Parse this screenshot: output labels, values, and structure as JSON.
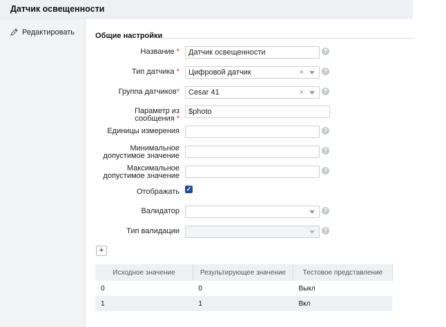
{
  "header": {
    "title": "Датчик освещенности"
  },
  "sidebar": {
    "edit_label": "Редактировать"
  },
  "section": {
    "title": "Общие настройки"
  },
  "form": {
    "name": {
      "label": "Название",
      "required": "*",
      "value": "Датчик освещенности"
    },
    "sensor_type": {
      "label": "Тип датчика",
      "required": "*",
      "value": "Цифровой датчик",
      "clear": "×"
    },
    "sensor_group": {
      "label": "Группа датчиков",
      "required": "*",
      "value": "Cesar 41",
      "clear": "×"
    },
    "message_param": {
      "label": "Параметр из сообщения",
      "required": "*",
      "value": "$photo"
    },
    "units": {
      "label": "Единицы измерения",
      "value": ""
    },
    "min_value": {
      "label_line1": "Минимальное",
      "label_line2": "допустимое значение",
      "value": ""
    },
    "max_value": {
      "label_line1": "Максимальное",
      "label_line2": "допустимое значение",
      "value": ""
    },
    "display": {
      "label": "Отображать",
      "checked": true,
      "check_glyph": "✓"
    },
    "validator": {
      "label": "Валидатор",
      "value": ""
    },
    "validation_type": {
      "label": "Тип валидации",
      "value": ""
    },
    "help_glyph": "?"
  },
  "add_button": {
    "label": "+"
  },
  "table": {
    "headers": [
      "Исходное значение",
      "Результирующее значение",
      "Тестовое представление"
    ],
    "rows": [
      [
        "0",
        "0",
        "Выкл"
      ],
      [
        "1",
        "1",
        "Вкл"
      ]
    ]
  }
}
